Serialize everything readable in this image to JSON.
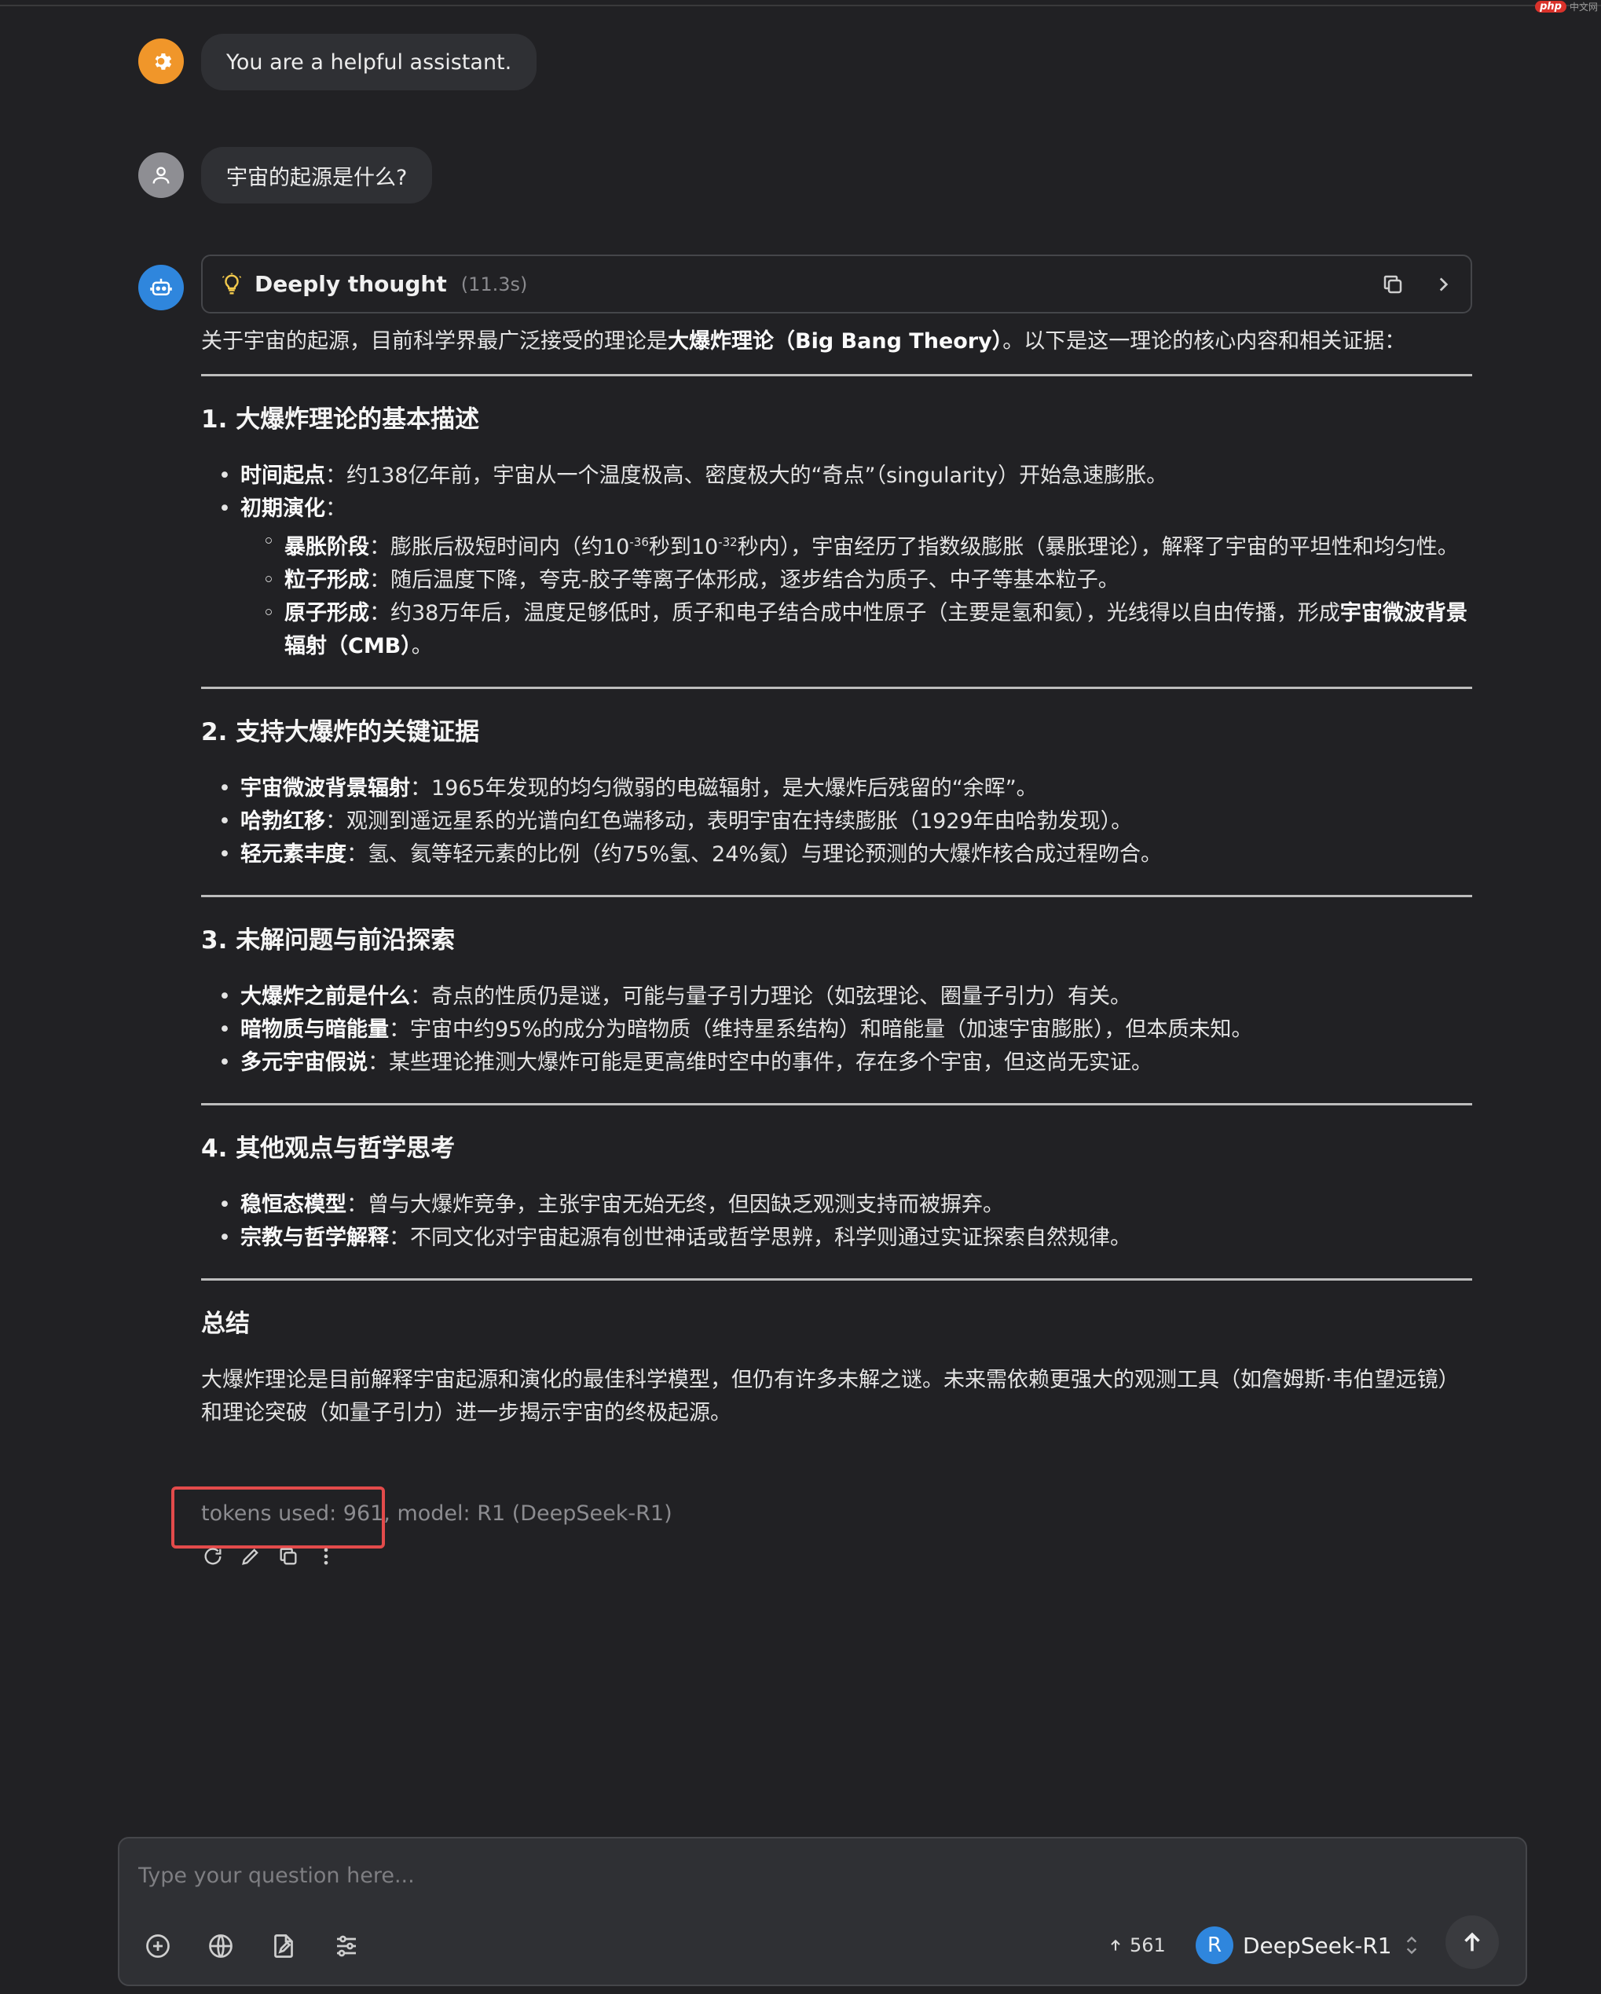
{
  "watermark": {
    "logo": "php",
    "text": "中文网"
  },
  "messages": {
    "system": {
      "text": "You are a helpful assistant."
    },
    "user": {
      "text": "宇宙的起源是什么?"
    },
    "assistant": {
      "thinking": {
        "title": "Deeply thought",
        "time": "(11.3s)"
      },
      "intro_prefix": "关于宇宙的起源，目前科学界最广泛接受的理论是",
      "intro_bold": "大爆炸理论（Big Bang Theory）",
      "intro_suffix": "。以下是这一理论的核心内容和相关证据：",
      "sections": [
        {
          "title": "1. 大爆炸理论的基本描述",
          "items": [
            {
              "bold": "时间起点",
              "text": "：约138亿年前，宇宙从一个温度极高、密度极大的“奇点”（singularity）开始急速膨胀。"
            },
            {
              "bold": "初期演化",
              "text": "："
            }
          ],
          "subitems": [
            {
              "bold": "暴胀阶段",
              "text_a": "：膨胀后极短时间内（约10",
              "sup_a": "-36",
              "text_b": "秒到10",
              "sup_b": "-32",
              "text_c": "秒内），宇宙经历了指数级膨胀（暴胀理论），解释了宇宙的平坦性和均匀性。"
            },
            {
              "bold": "粒子形成",
              "text": "：随后温度下降，夸克-胶子等离子体形成，逐步结合为质子、中子等基本粒子。"
            },
            {
              "bold": "原子形成",
              "text": "：约38万年后，温度足够低时，质子和电子结合成中性原子（主要是氢和氦），光线得以自由传播，形成",
              "bold_tail": "宇宙微波背景辐射（CMB）",
              "tail": "。"
            }
          ]
        },
        {
          "title": "2. 支持大爆炸的关键证据",
          "items": [
            {
              "bold": "宇宙微波背景辐射",
              "text": "：1965年发现的均匀微弱的电磁辐射，是大爆炸后残留的“余晖”。"
            },
            {
              "bold": "哈勃红移",
              "text": "：观测到遥远星系的光谱向红色端移动，表明宇宙在持续膨胀（1929年由哈勃发现）。"
            },
            {
              "bold": "轻元素丰度",
              "text": "：氢、氦等轻元素的比例（约75%氢、24%氦）与理论预测的大爆炸核合成过程吻合。"
            }
          ]
        },
        {
          "title": "3. 未解问题与前沿探索",
          "items": [
            {
              "bold": "大爆炸之前是什么",
              "text": "：奇点的性质仍是谜，可能与量子引力理论（如弦理论、圈量子引力）有关。"
            },
            {
              "bold": "暗物质与暗能量",
              "text": "：宇宙中约95%的成分为暗物质（维持星系结构）和暗能量（加速宇宙膨胀），但本质未知。"
            },
            {
              "bold": "多元宇宙假说",
              "text": "：某些理论推测大爆炸可能是更高维时空中的事件，存在多个宇宙，但这尚无实证。"
            }
          ]
        },
        {
          "title": "4. 其他观点与哲学思考",
          "items": [
            {
              "bold": "稳恒态模型",
              "text": "：曾与大爆炸竞争，主张宇宙无始无终，但因缺乏观测支持而被摒弃。"
            },
            {
              "bold": "宗教与哲学解释",
              "text": "：不同文化对宇宙起源有创世神话或哲学思辨，科学则通过实证探索自然规律。"
            }
          ]
        }
      ],
      "summary_title": "总结",
      "summary_text": "大爆炸理论是目前解释宇宙起源和演化的最佳科学模型，但仍有许多未解之谜。未来需依赖更强大的观测工具（如詹姆斯·韦伯望远镜）和理论突破（如量子引力）进一步揭示宇宙的终极起源。",
      "meta": "tokens used: 961, model: R1 (DeepSeek-R1)"
    }
  },
  "composer": {
    "placeholder": "Type your question here...",
    "token_count": "561",
    "model_initial": "R",
    "model_name": "DeepSeek-R1"
  }
}
